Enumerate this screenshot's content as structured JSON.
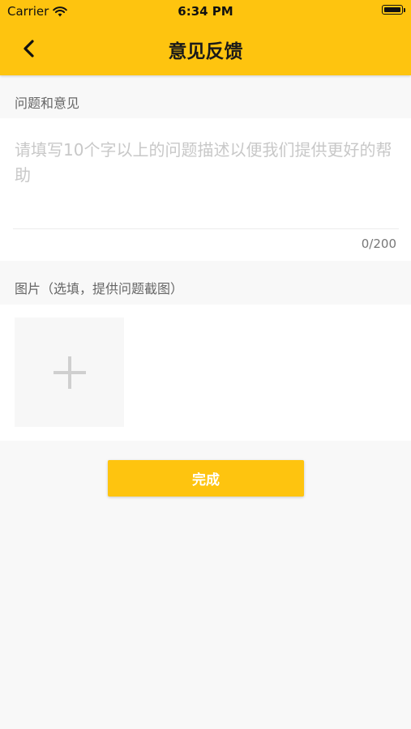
{
  "status_bar": {
    "carrier": "Carrier",
    "time": "6:34 PM"
  },
  "header": {
    "title": "意见反馈",
    "back_icon": "chevron-left-icon"
  },
  "feedback": {
    "section_label": "问题和意见",
    "value": "",
    "placeholder": "请填写10个字以上的问题描述以便我们提供更好的帮助",
    "char_count": "0/200"
  },
  "images": {
    "section_label": "图片（选填，提供问题截图）",
    "add_icon": "plus-icon"
  },
  "actions": {
    "submit_label": "完成"
  },
  "colors": {
    "accent": "#fec40f",
    "background": "#f8f8f8",
    "panel": "#ffffff"
  }
}
